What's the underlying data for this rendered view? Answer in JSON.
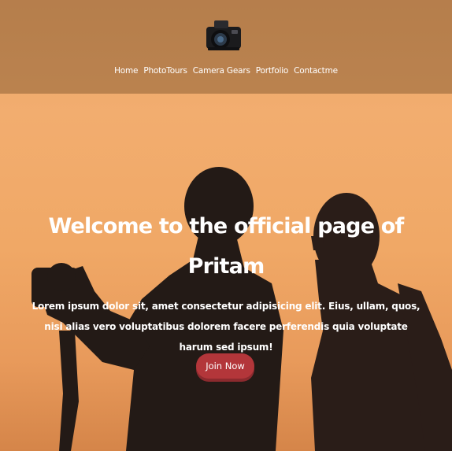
{
  "nav": {
    "items": [
      "Home",
      "PhotoTours",
      "Camera Gears",
      "Portfolio",
      "Contactme"
    ]
  },
  "hero": {
    "title": "Welcome to the official page of Pritam",
    "description": "Lorem ipsum dolor sit, amet consectetur adipisicing elit. Eius, ullam, quos, nisi alias vero voluptatibus dolorem facere perferendis quia voluptate harum sed ipsum!",
    "cta_label": "Join Now"
  },
  "colors": {
    "header_overlay": "#785028",
    "sky": "#f0a866",
    "button": "#b3363a",
    "text": "#ffffff"
  }
}
